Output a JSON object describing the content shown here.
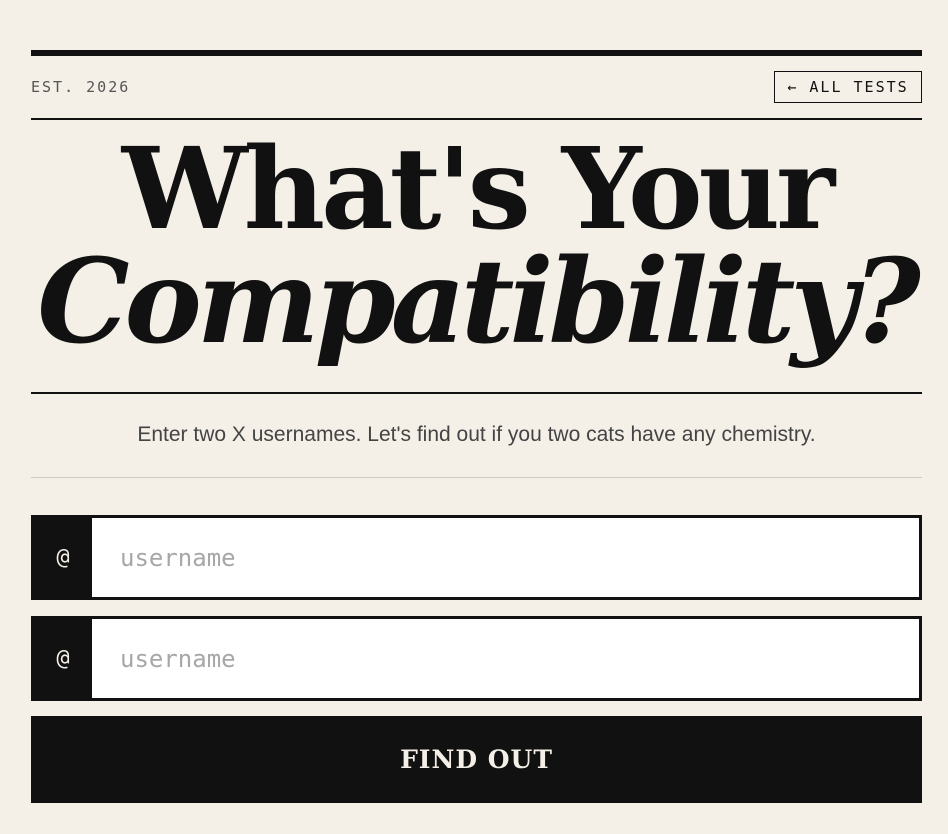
{
  "header": {
    "established": "EST. 2026",
    "back_link_label": "← ALL TESTS"
  },
  "title": {
    "line1": "What's Your",
    "line2": "Compatibility?"
  },
  "subtitle": "Enter two X usernames. Let's find out if you two cats have any chemistry.",
  "inputs": [
    {
      "prefix": "@",
      "placeholder": "username",
      "value": ""
    },
    {
      "prefix": "@",
      "placeholder": "username",
      "value": ""
    }
  ],
  "submit_label": "FIND OUT",
  "colors": {
    "background": "#f4efe7",
    "ink": "#111111",
    "input_bg": "#ffffff",
    "placeholder": "#a7a7a7"
  }
}
